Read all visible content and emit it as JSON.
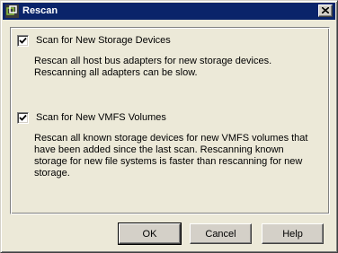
{
  "window": {
    "title": "Rescan",
    "icon": "vmware-logo-icon",
    "close_glyph": "×"
  },
  "options": [
    {
      "label": "Scan for New Storage Devices",
      "checked": true,
      "description": "Rescan all host bus adapters for new storage devices.\nRescanning all adapters can be slow."
    },
    {
      "label": "Scan for New VMFS Volumes",
      "checked": true,
      "description": "Rescan all known storage devices for new VMFS volumes that\nhave been added since the last scan. Rescanning known\nstorage for new file systems is faster than rescanning for new\nstorage."
    }
  ],
  "buttons": {
    "ok": "OK",
    "cancel": "Cancel",
    "help": "Help"
  },
  "colors": {
    "titlebar": "#0a246a",
    "face": "#ece9d8"
  }
}
